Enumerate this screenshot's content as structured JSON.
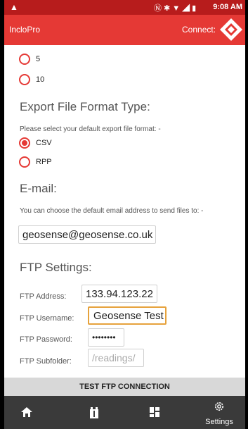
{
  "status_bar": {
    "time": "9:08 AM",
    "warning_icon": "warning-icon",
    "status_icons": [
      "nfc-icon",
      "bluetooth-icon",
      "wifi-icon",
      "signal-icon",
      "battery-icon"
    ]
  },
  "app_bar": {
    "title": "IncloPro",
    "connect_label": "Connect:",
    "connect_icon": "diamond-connect-icon"
  },
  "interval_options": [
    {
      "label": "5",
      "checked": false
    },
    {
      "label": "10",
      "checked": false
    }
  ],
  "export": {
    "title": "Export File Format Type:",
    "hint": "Please select your default export file format: -",
    "options": [
      {
        "label": "CSV",
        "checked": true
      },
      {
        "label": "RPP",
        "checked": false
      }
    ]
  },
  "email": {
    "title": "E-mail:",
    "hint": "You can choose the default email address to send files to: -",
    "value": "geosense@geosense.co.uk"
  },
  "ftp": {
    "title": "FTP Settings:",
    "address_label": "FTP Address:",
    "address_value": "133.94.123.22",
    "username_label": "FTP Username:",
    "username_value": "Geosense Test",
    "password_label": "FTP Password:",
    "password_value": "••••••••",
    "subfolder_label": "FTP Subfolder:",
    "subfolder_placeholder": "/readings/"
  },
  "test_button": "TEST FTP CONNECTION",
  "bottom_nav": [
    {
      "icon": "home-icon",
      "label": ""
    },
    {
      "icon": "instrument-icon",
      "label": ""
    },
    {
      "icon": "dashboard-icon",
      "label": ""
    },
    {
      "icon": "gear-icon",
      "label": "Settings"
    }
  ],
  "colors": {
    "accent": "#e53935",
    "status_bar": "#b71c1c",
    "nav_bg": "#3a3a3a",
    "focus_border": "#e6a23c"
  }
}
